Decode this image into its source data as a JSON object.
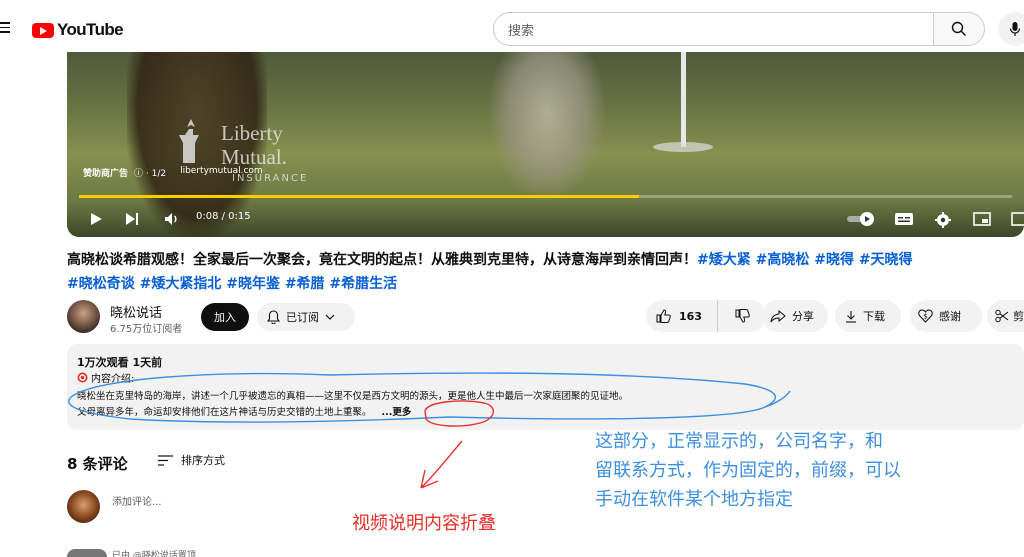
{
  "header": {
    "logo_text": "YouTube",
    "search_placeholder": "搜索"
  },
  "player": {
    "ad_label": "赞助商广告",
    "ad_counter": "ⓘ · 1/2",
    "ad_link": "libertymutual.com",
    "watermark_line1": "Liberty",
    "watermark_line2": "Mutual.",
    "watermark_line3": "INSURANCE",
    "time": "0:08 / 0:15",
    "progress_fraction": 0.6,
    "progress_color": "#ffcc00"
  },
  "video": {
    "title_line1": "高晓松谈希腊观感！全家最后一次聚会，竟在文明的起点！从雅典到克里特，从诗意海岸到亲情回声！",
    "title_line1_tags": "#矮大紧 #高晓松 #晓得 #天晓得",
    "title_line2": "#晓松奇谈 #矮大紧指北 #晓年鉴 #希腊 #希腊生活"
  },
  "channel": {
    "name": "晓松说话",
    "subscribers": "6.75万位订阅者",
    "join_label": "加入",
    "subscribed_label": "已订阅"
  },
  "actions": {
    "like_count": "163",
    "share_label": "分享",
    "download_label": "下载",
    "thanks_label": "感谢",
    "clip_label": "剪"
  },
  "description": {
    "views": "1万次观看  1天前",
    "intro": "内容介绍:",
    "line1": "晓松坐在克里特岛的海岸，讲述一个几乎被遗忘的真相——这里不仅是西方文明的源头，更是他人生中最后一次家庭团聚的见证地。",
    "line2": "父母离异多年，命运却安排他们在这片神话与历史交错的土地上重聚。",
    "more": "...更多"
  },
  "comments": {
    "count": "8 条评论",
    "sort_label": "排序方式",
    "add_placeholder": "添加评论...",
    "partial_text": "已由 @晓松说话置顶"
  },
  "annotations": {
    "blue_line1": "这部分，正常显示的，公司名字，和",
    "blue_line2": "留联系方式，作为固定的，前缀，可以",
    "blue_line3": "手动在软件某个地方指定",
    "red_text": "视频说明内容折叠",
    "blue_color": "#3d8fe0",
    "red_color": "#e8302a"
  }
}
